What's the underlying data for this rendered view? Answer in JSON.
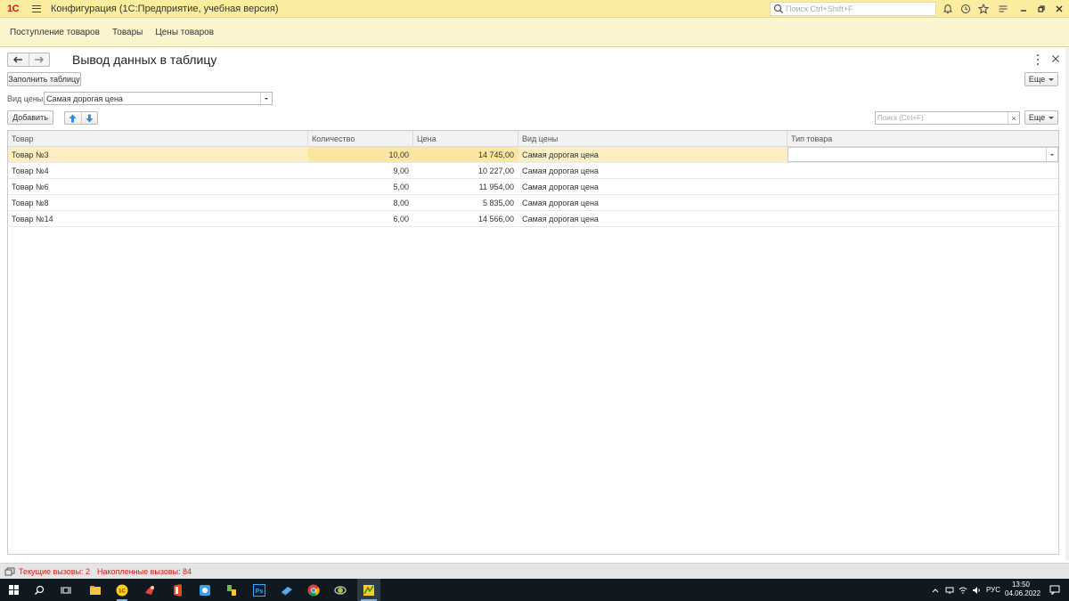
{
  "app": {
    "logo_text": "1С",
    "title": "Конфигурация  (1С:Предприятие, учебная версия)",
    "search_placeholder": "Поиск Ctrl+Shift+F"
  },
  "sections": [
    "Поступление товаров",
    "Товары",
    "Цены товаров"
  ],
  "form": {
    "title": "Вывод данных в таблицу",
    "fill_button": "Заполнить таблицу",
    "more_label": "Еще",
    "price_type_label": "Вид цены:",
    "price_type_value": "Самая дорогая цена",
    "add_button": "Добавить",
    "search_placeholder": "Поиск (Ctrl+F)",
    "search_clear": "×"
  },
  "table": {
    "columns": [
      "Товар",
      "Количество",
      "Цена",
      "Вид цены",
      "Тип товара"
    ],
    "rows": [
      {
        "product": "Товар №3",
        "qty": "10,00",
        "price": "14 745,00",
        "price_type": "Самая дорогая цена",
        "product_type": ""
      },
      {
        "product": "Товар №4",
        "qty": "9,00",
        "price": "10 227,00",
        "price_type": "Самая дорогая цена",
        "product_type": ""
      },
      {
        "product": "Товар №6",
        "qty": "5,00",
        "price": "11 954,00",
        "price_type": "Самая дорогая цена",
        "product_type": ""
      },
      {
        "product": "Товар №8",
        "qty": "8,00",
        "price": "5 835,00",
        "price_type": "Самая дорогая цена",
        "product_type": ""
      },
      {
        "product": "Товар №14",
        "qty": "6,00",
        "price": "14 566,00",
        "price_type": "Самая дорогая цена",
        "product_type": ""
      }
    ]
  },
  "status": {
    "current_calls": "Текущие вызовы: 2",
    "accumulated_calls": "Накопленные вызовы: 84"
  },
  "taskbar": {
    "lang": "РУС",
    "time": "13:50",
    "date": "04.06.2022"
  },
  "colors": {
    "title_bar": "#fbeda0",
    "section_panel": "#fbf5cf",
    "selected_row": "#fbeec0",
    "status_text": "#d31b1b",
    "taskbar": "#101820"
  }
}
